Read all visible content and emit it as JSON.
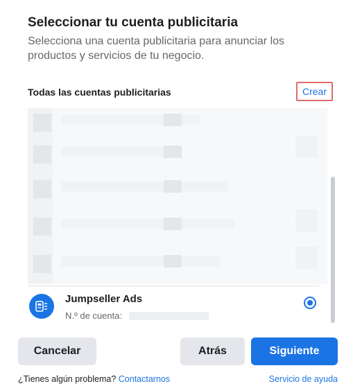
{
  "dialog": {
    "title": "Seleccionar tu cuenta publicitaria",
    "subtitle": "Selecciona una cuenta publicitaria para anunciar los productos y servicios de tu negocio."
  },
  "accounts_section": {
    "label": "Todas las cuentas publicitarias",
    "create_label": "Crear"
  },
  "selected_account": {
    "name": "Jumpseller Ads",
    "number_label": "N.º de cuenta:",
    "icon": "ad-account-icon",
    "selected": true
  },
  "buttons": {
    "cancel": "Cancelar",
    "back": "Atrás",
    "next": "Siguiente"
  },
  "footer": {
    "problem_text": "¿Tienes algún problema?",
    "contact_link": "Contactarnos",
    "help_link": "Servicio de ayuda"
  },
  "colors": {
    "accent": "#1b74e4",
    "highlight_border": "#e26a6a"
  }
}
